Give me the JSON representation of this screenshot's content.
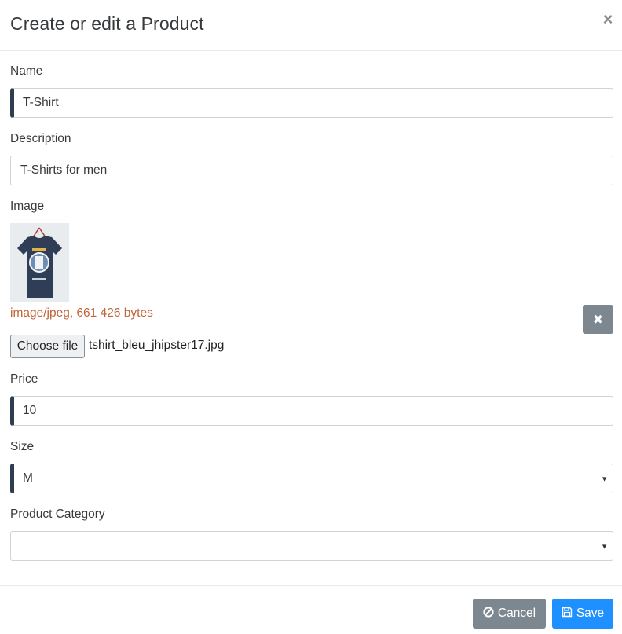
{
  "header": {
    "title": "Create or edit a Product",
    "close_glyph": "×"
  },
  "fields": {
    "name": {
      "label": "Name",
      "value": "T-Shirt"
    },
    "description": {
      "label": "Description",
      "value": "T-Shirts for men"
    },
    "image": {
      "label": "Image",
      "meta": "image/jpeg, 661 426 bytes",
      "clear_glyph": "✖",
      "choose_file_label": "Choose file",
      "file_name": "tshirt_bleu_jhipster17.jpg"
    },
    "price": {
      "label": "Price",
      "value": "10"
    },
    "size": {
      "label": "Size",
      "value": "M"
    },
    "product_category": {
      "label": "Product Category",
      "value": ""
    }
  },
  "footer": {
    "cancel_label": "Cancel",
    "save_label": "Save"
  },
  "colors": {
    "accent": "#1e90ff",
    "secondary": "#7d8790",
    "invalid_marker": "#2c3e50",
    "meta_text": "#c0643a"
  }
}
